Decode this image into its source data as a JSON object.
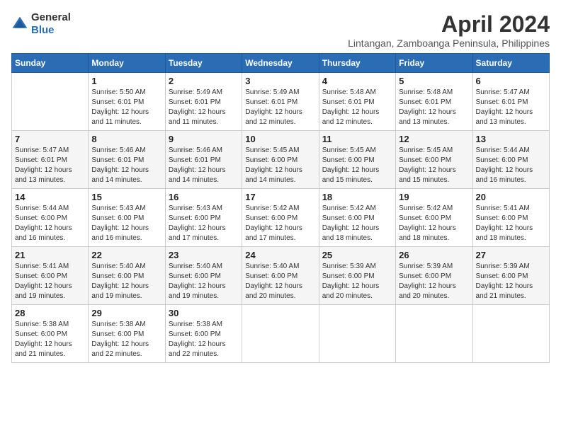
{
  "logo": {
    "text_general": "General",
    "text_blue": "Blue"
  },
  "calendar": {
    "title": "April 2024",
    "subtitle": "Lintangan, Zamboanga Peninsula, Philippines"
  },
  "headers": [
    "Sunday",
    "Monday",
    "Tuesday",
    "Wednesday",
    "Thursday",
    "Friday",
    "Saturday"
  ],
  "weeks": [
    [
      {
        "day": "",
        "sunrise": "",
        "sunset": "",
        "daylight": ""
      },
      {
        "day": "1",
        "sunrise": "Sunrise: 5:50 AM",
        "sunset": "Sunset: 6:01 PM",
        "daylight": "Daylight: 12 hours and 11 minutes."
      },
      {
        "day": "2",
        "sunrise": "Sunrise: 5:49 AM",
        "sunset": "Sunset: 6:01 PM",
        "daylight": "Daylight: 12 hours and 11 minutes."
      },
      {
        "day": "3",
        "sunrise": "Sunrise: 5:49 AM",
        "sunset": "Sunset: 6:01 PM",
        "daylight": "Daylight: 12 hours and 12 minutes."
      },
      {
        "day": "4",
        "sunrise": "Sunrise: 5:48 AM",
        "sunset": "Sunset: 6:01 PM",
        "daylight": "Daylight: 12 hours and 12 minutes."
      },
      {
        "day": "5",
        "sunrise": "Sunrise: 5:48 AM",
        "sunset": "Sunset: 6:01 PM",
        "daylight": "Daylight: 12 hours and 13 minutes."
      },
      {
        "day": "6",
        "sunrise": "Sunrise: 5:47 AM",
        "sunset": "Sunset: 6:01 PM",
        "daylight": "Daylight: 12 hours and 13 minutes."
      }
    ],
    [
      {
        "day": "7",
        "sunrise": "Sunrise: 5:47 AM",
        "sunset": "Sunset: 6:01 PM",
        "daylight": "Daylight: 12 hours and 13 minutes."
      },
      {
        "day": "8",
        "sunrise": "Sunrise: 5:46 AM",
        "sunset": "Sunset: 6:01 PM",
        "daylight": "Daylight: 12 hours and 14 minutes."
      },
      {
        "day": "9",
        "sunrise": "Sunrise: 5:46 AM",
        "sunset": "Sunset: 6:01 PM",
        "daylight": "Daylight: 12 hours and 14 minutes."
      },
      {
        "day": "10",
        "sunrise": "Sunrise: 5:45 AM",
        "sunset": "Sunset: 6:00 PM",
        "daylight": "Daylight: 12 hours and 14 minutes."
      },
      {
        "day": "11",
        "sunrise": "Sunrise: 5:45 AM",
        "sunset": "Sunset: 6:00 PM",
        "daylight": "Daylight: 12 hours and 15 minutes."
      },
      {
        "day": "12",
        "sunrise": "Sunrise: 5:45 AM",
        "sunset": "Sunset: 6:00 PM",
        "daylight": "Daylight: 12 hours and 15 minutes."
      },
      {
        "day": "13",
        "sunrise": "Sunrise: 5:44 AM",
        "sunset": "Sunset: 6:00 PM",
        "daylight": "Daylight: 12 hours and 16 minutes."
      }
    ],
    [
      {
        "day": "14",
        "sunrise": "Sunrise: 5:44 AM",
        "sunset": "Sunset: 6:00 PM",
        "daylight": "Daylight: 12 hours and 16 minutes."
      },
      {
        "day": "15",
        "sunrise": "Sunrise: 5:43 AM",
        "sunset": "Sunset: 6:00 PM",
        "daylight": "Daylight: 12 hours and 16 minutes."
      },
      {
        "day": "16",
        "sunrise": "Sunrise: 5:43 AM",
        "sunset": "Sunset: 6:00 PM",
        "daylight": "Daylight: 12 hours and 17 minutes."
      },
      {
        "day": "17",
        "sunrise": "Sunrise: 5:42 AM",
        "sunset": "Sunset: 6:00 PM",
        "daylight": "Daylight: 12 hours and 17 minutes."
      },
      {
        "day": "18",
        "sunrise": "Sunrise: 5:42 AM",
        "sunset": "Sunset: 6:00 PM",
        "daylight": "Daylight: 12 hours and 18 minutes."
      },
      {
        "day": "19",
        "sunrise": "Sunrise: 5:42 AM",
        "sunset": "Sunset: 6:00 PM",
        "daylight": "Daylight: 12 hours and 18 minutes."
      },
      {
        "day": "20",
        "sunrise": "Sunrise: 5:41 AM",
        "sunset": "Sunset: 6:00 PM",
        "daylight": "Daylight: 12 hours and 18 minutes."
      }
    ],
    [
      {
        "day": "21",
        "sunrise": "Sunrise: 5:41 AM",
        "sunset": "Sunset: 6:00 PM",
        "daylight": "Daylight: 12 hours and 19 minutes."
      },
      {
        "day": "22",
        "sunrise": "Sunrise: 5:40 AM",
        "sunset": "Sunset: 6:00 PM",
        "daylight": "Daylight: 12 hours and 19 minutes."
      },
      {
        "day": "23",
        "sunrise": "Sunrise: 5:40 AM",
        "sunset": "Sunset: 6:00 PM",
        "daylight": "Daylight: 12 hours and 19 minutes."
      },
      {
        "day": "24",
        "sunrise": "Sunrise: 5:40 AM",
        "sunset": "Sunset: 6:00 PM",
        "daylight": "Daylight: 12 hours and 20 minutes."
      },
      {
        "day": "25",
        "sunrise": "Sunrise: 5:39 AM",
        "sunset": "Sunset: 6:00 PM",
        "daylight": "Daylight: 12 hours and 20 minutes."
      },
      {
        "day": "26",
        "sunrise": "Sunrise: 5:39 AM",
        "sunset": "Sunset: 6:00 PM",
        "daylight": "Daylight: 12 hours and 20 minutes."
      },
      {
        "day": "27",
        "sunrise": "Sunrise: 5:39 AM",
        "sunset": "Sunset: 6:00 PM",
        "daylight": "Daylight: 12 hours and 21 minutes."
      }
    ],
    [
      {
        "day": "28",
        "sunrise": "Sunrise: 5:38 AM",
        "sunset": "Sunset: 6:00 PM",
        "daylight": "Daylight: 12 hours and 21 minutes."
      },
      {
        "day": "29",
        "sunrise": "Sunrise: 5:38 AM",
        "sunset": "Sunset: 6:00 PM",
        "daylight": "Daylight: 12 hours and 22 minutes."
      },
      {
        "day": "30",
        "sunrise": "Sunrise: 5:38 AM",
        "sunset": "Sunset: 6:00 PM",
        "daylight": "Daylight: 12 hours and 22 minutes."
      },
      {
        "day": "",
        "sunrise": "",
        "sunset": "",
        "daylight": ""
      },
      {
        "day": "",
        "sunrise": "",
        "sunset": "",
        "daylight": ""
      },
      {
        "day": "",
        "sunrise": "",
        "sunset": "",
        "daylight": ""
      },
      {
        "day": "",
        "sunrise": "",
        "sunset": "",
        "daylight": ""
      }
    ]
  ]
}
